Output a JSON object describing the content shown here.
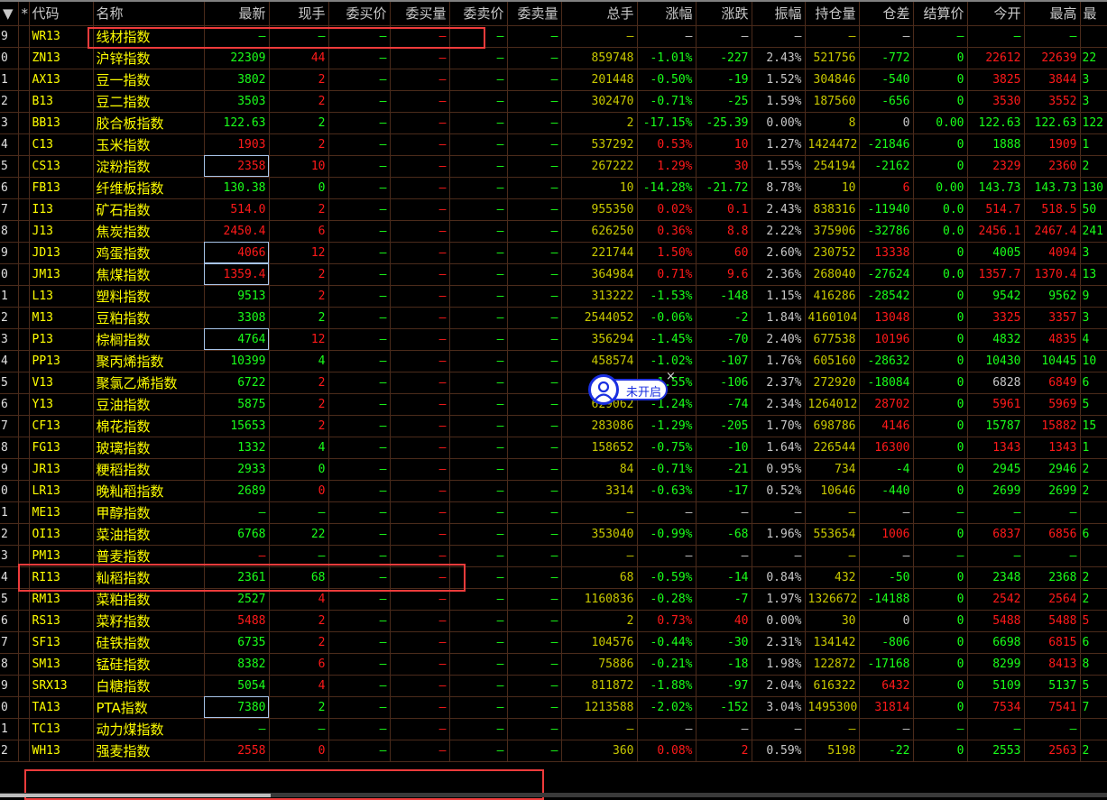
{
  "colors": {
    "up": "#ff1a1a",
    "down": "#1aff1a",
    "volume": "#c8c800",
    "neutral": "#c8c8c8",
    "code": "#ffff00",
    "annotation": "#ee3b3b",
    "badge": "#1a2fe0"
  },
  "header": [
    "▼",
    "*",
    "代码",
    "名称",
    "最新",
    "现手",
    "委买价",
    "委买量",
    "委卖价",
    "委卖量",
    "总手",
    "涨幅",
    "涨跌",
    "振幅",
    "持仓量",
    "仓差",
    "结算价",
    "今开",
    "最高",
    "最"
  ],
  "dash": "—",
  "badge": {
    "icon": "user-circle-icon",
    "label": "未开启",
    "close": "×"
  },
  "rows": [
    {
      "i": "9",
      "code": "WR13",
      "name": "线材指数",
      "v": [],
      "c": "gggg-",
      "box": "wr"
    },
    {
      "i": "0",
      "code": "ZN13",
      "name": "沪锌指数",
      "v": [
        "22309",
        "44",
        "859748",
        "-1.01%",
        "-227",
        "2.43%",
        "521756",
        "-772",
        "0",
        "22612",
        "22639",
        "22"
      ],
      "c": "grrrg"
    },
    {
      "i": "1",
      "code": "AX13",
      "name": "豆一指数",
      "v": [
        "3802",
        "2",
        "201448",
        "-0.50%",
        "-19",
        "1.52%",
        "304846",
        "-540",
        "0",
        "3825",
        "3844",
        "3"
      ],
      "c": "grrrg"
    },
    {
      "i": "2",
      "code": "B13",
      "name": "豆二指数",
      "v": [
        "3503",
        "2",
        "302470",
        "-0.71%",
        "-25",
        "1.59%",
        "187560",
        "-656",
        "0",
        "3530",
        "3552",
        "3"
      ],
      "c": "grrrg"
    },
    {
      "i": "3",
      "code": "BB13",
      "name": "胶合板指数",
      "v": [
        "122.63",
        "2",
        "2",
        "-17.15%",
        "-25.39",
        "0.00%",
        "8",
        "0",
        "0.00",
        "122.63",
        "122.63",
        "122"
      ],
      "c": "ggggg"
    },
    {
      "i": "4",
      "code": "C13",
      "name": "玉米指数",
      "v": [
        "1903",
        "2",
        "537292",
        "0.53%",
        "10",
        "1.27%",
        "1424472",
        "-21846",
        "0",
        "1888",
        "1909",
        "1"
      ],
      "c": "rrgrg"
    },
    {
      "i": "5",
      "code": "CS13",
      "name": "淀粉指数",
      "v": [
        "2358",
        "10",
        "267222",
        "1.29%",
        "30",
        "1.55%",
        "254194",
        "-2162",
        "0",
        "2329",
        "2360",
        "2"
      ],
      "c": "rrrrg",
      "sel": true
    },
    {
      "i": "6",
      "code": "FB13",
      "name": "纤维板指数",
      "v": [
        "130.38",
        "0",
        "10",
        "-14.28%",
        "-21.72",
        "8.78%",
        "10",
        "6",
        "0.00",
        "143.73",
        "143.73",
        "130"
      ],
      "c": "ggggg"
    },
    {
      "i": "7",
      "code": "I13",
      "name": "矿石指数",
      "v": [
        "514.0",
        "2",
        "955350",
        "0.02%",
        "0.1",
        "2.43%",
        "838316",
        "-11940",
        "0.0",
        "514.7",
        "518.5",
        "50"
      ],
      "c": "rrrrg"
    },
    {
      "i": "8",
      "code": "J13",
      "name": "焦炭指数",
      "v": [
        "2450.4",
        "6",
        "626250",
        "0.36%",
        "8.8",
        "2.22%",
        "375906",
        "-32786",
        "0.0",
        "2456.1",
        "2467.4",
        "241"
      ],
      "c": "rrrrg"
    },
    {
      "i": "9",
      "code": "JD13",
      "name": "鸡蛋指数",
      "v": [
        "4066",
        "12",
        "221744",
        "1.50%",
        "60",
        "2.60%",
        "230752",
        "13338",
        "0",
        "4005",
        "4094",
        "3"
      ],
      "c": "rrgrg",
      "sel": true
    },
    {
      "i": "0",
      "code": "JM13",
      "name": "焦煤指数",
      "v": [
        "1359.4",
        "2",
        "364984",
        "0.71%",
        "9.6",
        "2.36%",
        "268040",
        "-27624",
        "0.0",
        "1357.7",
        "1370.4",
        "13"
      ],
      "c": "rrrrg",
      "sel": true
    },
    {
      "i": "1",
      "code": "L13",
      "name": "塑料指数",
      "v": [
        "9513",
        "2",
        "313222",
        "-1.53%",
        "-148",
        "1.15%",
        "416286",
        "-28542",
        "0",
        "9542",
        "9562",
        "9"
      ],
      "c": "grggg"
    },
    {
      "i": "2",
      "code": "M13",
      "name": "豆粕指数",
      "v": [
        "3308",
        "2",
        "2544052",
        "-0.06%",
        "-2",
        "1.84%",
        "4160104",
        "13048",
        "0",
        "3325",
        "3357",
        "3"
      ],
      "c": "ggrrg"
    },
    {
      "i": "3",
      "code": "P13",
      "name": "棕榈指数",
      "v": [
        "4764",
        "12",
        "356294",
        "-1.45%",
        "-70",
        "2.40%",
        "677538",
        "10196",
        "0",
        "4832",
        "4835",
        "4"
      ],
      "c": "grgrg",
      "sel": true
    },
    {
      "i": "4",
      "code": "PP13",
      "name": "聚丙烯指数",
      "v": [
        "10399",
        "4",
        "458574",
        "-1.02%",
        "-107",
        "1.76%",
        "605160",
        "-28632",
        "0",
        "10430",
        "10445",
        "10"
      ],
      "c": "ggggg"
    },
    {
      "i": "5",
      "code": "V13",
      "name": "聚氯乙烯指数",
      "v": [
        "6722",
        "2",
        "",
        "-1.55%",
        "-106",
        "2.37%",
        "272920",
        "-18084",
        "0",
        "6828",
        "6849",
        "6"
      ],
      "c": "grwrg"
    },
    {
      "i": "6",
      "code": "Y13",
      "name": "豆油指数",
      "v": [
        "5875",
        "2",
        "629062",
        "-1.24%",
        "-74",
        "2.34%",
        "1264012",
        "28702",
        "0",
        "5961",
        "5969",
        "5"
      ],
      "c": "grrrg"
    },
    {
      "i": "7",
      "code": "CF13",
      "name": "棉花指数",
      "v": [
        "15653",
        "2",
        "283086",
        "-1.29%",
        "-205",
        "1.70%",
        "698786",
        "4146",
        "0",
        "15787",
        "15882",
        "15"
      ],
      "c": "grgrg"
    },
    {
      "i": "8",
      "code": "FG13",
      "name": "玻璃指数",
      "v": [
        "1332",
        "4",
        "158652",
        "-0.75%",
        "-10",
        "1.64%",
        "226544",
        "16300",
        "0",
        "1343",
        "1343",
        "1"
      ],
      "c": "ggrrg"
    },
    {
      "i": "9",
      "code": "JR13",
      "name": "粳稻指数",
      "v": [
        "2933",
        "0",
        "84",
        "-0.71%",
        "-21",
        "0.95%",
        "734",
        "-4",
        "0",
        "2945",
        "2946",
        "2"
      ],
      "c": "ggggg"
    },
    {
      "i": "0",
      "code": "LR13",
      "name": "晚籼稻指数",
      "v": [
        "2689",
        "0",
        "3314",
        "-0.63%",
        "-17",
        "0.52%",
        "10646",
        "-440",
        "0",
        "2699",
        "2699",
        "2"
      ],
      "c": "grggg"
    },
    {
      "i": "1",
      "code": "ME13",
      "name": "甲醇指数",
      "v": [],
      "c": "gggg-"
    },
    {
      "i": "2",
      "code": "OI13",
      "name": "菜油指数",
      "v": [
        "6768",
        "22",
        "353040",
        "-0.99%",
        "-68",
        "1.96%",
        "553654",
        "1006",
        "0",
        "6837",
        "6856",
        "6"
      ],
      "c": "ggrrg"
    },
    {
      "i": "3",
      "code": "PM13",
      "name": "普麦指数",
      "v": [],
      "c": "rggg-",
      "box": "pm"
    },
    {
      "i": "4",
      "code": "RI13",
      "name": "籼稻指数",
      "v": [
        "2361",
        "68",
        "68",
        "-0.59%",
        "-14",
        "0.84%",
        "432",
        "-50",
        "0",
        "2348",
        "2368",
        "2"
      ],
      "c": "ggggg"
    },
    {
      "i": "5",
      "code": "RM13",
      "name": "菜粕指数",
      "v": [
        "2527",
        "4",
        "1160836",
        "-0.28%",
        "-7",
        "1.97%",
        "1326672",
        "-14188",
        "0",
        "2542",
        "2564",
        "2"
      ],
      "c": "grrrg"
    },
    {
      "i": "6",
      "code": "RS13",
      "name": "菜籽指数",
      "v": [
        "5488",
        "2",
        "2",
        "0.73%",
        "40",
        "0.00%",
        "30",
        "0",
        "0",
        "5488",
        "5488",
        "5"
      ],
      "c": "rrrrr"
    },
    {
      "i": "7",
      "code": "SF13",
      "name": "硅铁指数",
      "v": [
        "6735",
        "2",
        "104576",
        "-0.44%",
        "-30",
        "2.31%",
        "134142",
        "-806",
        "0",
        "6698",
        "6815",
        "6"
      ],
      "c": "grgrg"
    },
    {
      "i": "8",
      "code": "SM13",
      "name": "锰硅指数",
      "v": [
        "8382",
        "6",
        "75886",
        "-0.21%",
        "-18",
        "1.98%",
        "122872",
        "-17168",
        "0",
        "8299",
        "8413",
        "8"
      ],
      "c": "grgrg"
    },
    {
      "i": "9",
      "code": "SRX13",
      "name": "白糖指数",
      "v": [
        "5054",
        "4",
        "811872",
        "-1.88%",
        "-97",
        "2.04%",
        "616322",
        "6432",
        "0",
        "5109",
        "5137",
        "5"
      ],
      "c": "grggg"
    },
    {
      "i": "0",
      "code": "TA13",
      "name": "PTA指数",
      "v": [
        "7380",
        "2",
        "1213588",
        "-2.02%",
        "-152",
        "3.04%",
        "1495300",
        "31814",
        "0",
        "7534",
        "7541",
        "7"
      ],
      "c": "ggrrg",
      "sel": true
    },
    {
      "i": "1",
      "code": "TC13",
      "name": "动力煤指数",
      "v": [],
      "c": "gggg-"
    },
    {
      "i": "2",
      "code": "WH13",
      "name": "强麦指数",
      "v": [
        "2558",
        "0",
        "360",
        "0.08%",
        "2",
        "0.59%",
        "5198",
        "-22",
        "0",
        "2553",
        "2563",
        "2"
      ],
      "c": "rrgrg",
      "box": "wh"
    }
  ]
}
